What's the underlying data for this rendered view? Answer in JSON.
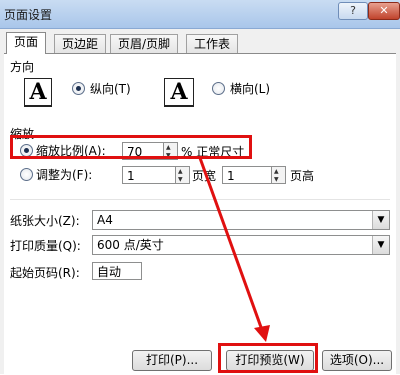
{
  "window": {
    "title": "页面设置",
    "help_glyph": "?",
    "close_glyph": "✕"
  },
  "tabs": [
    {
      "label": "页面",
      "active": true
    },
    {
      "label": "页边距",
      "active": false
    },
    {
      "label": "页眉/页脚",
      "active": false
    },
    {
      "label": "工作表",
      "active": false
    }
  ],
  "orientation": {
    "section_label": "方向",
    "icon_letter": "A",
    "portrait_label": "纵向(T)",
    "landscape_label": "横向(L)",
    "selected": "portrait"
  },
  "scaling": {
    "section_label": "缩放",
    "adjust_label": "缩放比例(A):",
    "adjust_value": "70",
    "percent_label": "% 正常尺寸",
    "fit_label": "调整为(F):",
    "fit_wide_value": "1",
    "fit_wide_label": "页宽",
    "fit_tall_value": "1",
    "fit_tall_label": "页高",
    "selected": "adjust"
  },
  "paper": {
    "size_label": "纸张大小(Z):",
    "size_value": "A4",
    "quality_label": "打印质量(Q):",
    "quality_value": "600 点/英寸",
    "first_page_label": "起始页码(R):",
    "first_page_value": "自动"
  },
  "buttons": {
    "print": "打印(P)...",
    "print_preview": "打印预览(W)",
    "options": "选项(O)..."
  },
  "colors": {
    "highlight": "#e01010"
  }
}
